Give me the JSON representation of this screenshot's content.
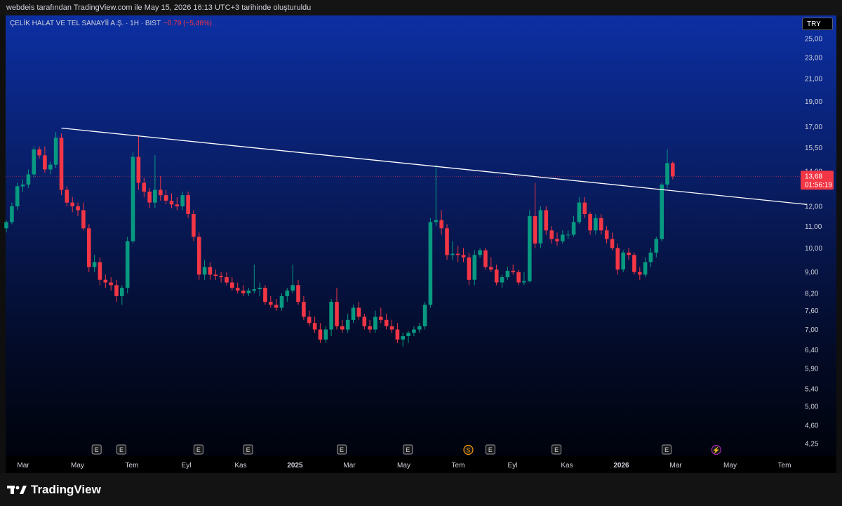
{
  "header_text": "webdeis tarafından TradingView.com ile May 15, 2026 16:13 UTC+3 tarihinde oluşturuldu",
  "legend": {
    "symbol": "ÇELİK HALAT VE TEL SANAYİİ A.Ş. · 1H · BIST",
    "change": "−0,79 (−5,46%)"
  },
  "currency": "TRY",
  "current_price": {
    "price": "13,68",
    "countdown": "01:56:19"
  },
  "brand": "TradingView",
  "colors": {
    "up": "#089981",
    "down": "#f23645",
    "trendline": "#ffffff",
    "event_dividend": "#ff9800",
    "event_split": "#9c27b0"
  },
  "chart_data": {
    "type": "candlestick",
    "currency": "TRY",
    "y_scale": "log",
    "y_ticks": [
      "25,00",
      "23,00",
      "21,00",
      "19,00",
      "17,00",
      "15,50",
      "14,00",
      "12,00",
      "11,00",
      "10,00",
      "9,00",
      "8,20",
      "7,60",
      "7,00",
      "6,40",
      "5,90",
      "5,40",
      "5,00",
      "4,60",
      "4,25"
    ],
    "x_ticks": [
      "Mar",
      "May",
      "Tem",
      "Eyl",
      "Kas",
      "2025",
      "Mar",
      "May",
      "Tem",
      "Eyl",
      "Kas",
      "2026",
      "Mar",
      "May",
      "Tem"
    ],
    "candles": [
      {
        "o": 10.9,
        "h": 11.3,
        "l": 10.7,
        "c": 11.2
      },
      {
        "o": 11.2,
        "h": 12.2,
        "l": 11.1,
        "c": 12.0
      },
      {
        "o": 12.0,
        "h": 13.3,
        "l": 11.8,
        "c": 13.1
      },
      {
        "o": 13.1,
        "h": 13.5,
        "l": 12.8,
        "c": 13.2
      },
      {
        "o": 13.2,
        "h": 14.1,
        "l": 13.0,
        "c": 13.8
      },
      {
        "o": 13.8,
        "h": 15.6,
        "l": 13.6,
        "c": 15.4
      },
      {
        "o": 15.4,
        "h": 15.6,
        "l": 14.8,
        "c": 15.0
      },
      {
        "o": 15.0,
        "h": 15.6,
        "l": 13.9,
        "c": 14.1
      },
      {
        "o": 14.1,
        "h": 14.6,
        "l": 13.8,
        "c": 14.4
      },
      {
        "o": 14.4,
        "h": 16.6,
        "l": 14.2,
        "c": 16.2
      },
      {
        "o": 16.2,
        "h": 16.5,
        "l": 12.6,
        "c": 12.9
      },
      {
        "o": 12.9,
        "h": 13.1,
        "l": 12.0,
        "c": 12.2
      },
      {
        "o": 12.2,
        "h": 12.5,
        "l": 11.7,
        "c": 12.0
      },
      {
        "o": 12.0,
        "h": 12.2,
        "l": 11.5,
        "c": 11.8
      },
      {
        "o": 11.8,
        "h": 12.2,
        "l": 10.8,
        "c": 10.9
      },
      {
        "o": 10.9,
        "h": 11.1,
        "l": 9.0,
        "c": 9.2
      },
      {
        "o": 9.2,
        "h": 9.7,
        "l": 9.0,
        "c": 9.4
      },
      {
        "o": 9.4,
        "h": 9.6,
        "l": 8.5,
        "c": 8.7
      },
      {
        "o": 8.7,
        "h": 8.9,
        "l": 8.4,
        "c": 8.6
      },
      {
        "o": 8.6,
        "h": 8.8,
        "l": 8.3,
        "c": 8.5
      },
      {
        "o": 8.5,
        "h": 8.7,
        "l": 7.9,
        "c": 8.1
      },
      {
        "o": 8.1,
        "h": 8.5,
        "l": 7.8,
        "c": 8.4
      },
      {
        "o": 8.4,
        "h": 10.5,
        "l": 8.2,
        "c": 10.3
      },
      {
        "o": 10.3,
        "h": 15.2,
        "l": 10.2,
        "c": 14.9
      },
      {
        "o": 14.9,
        "h": 16.4,
        "l": 12.9,
        "c": 13.3
      },
      {
        "o": 13.3,
        "h": 13.6,
        "l": 12.5,
        "c": 12.8
      },
      {
        "o": 12.8,
        "h": 13.0,
        "l": 11.9,
        "c": 12.2
      },
      {
        "o": 12.2,
        "h": 15.0,
        "l": 11.9,
        "c": 12.9
      },
      {
        "o": 12.9,
        "h": 13.7,
        "l": 12.3,
        "c": 12.6
      },
      {
        "o": 12.6,
        "h": 12.9,
        "l": 12.1,
        "c": 12.3
      },
      {
        "o": 12.3,
        "h": 12.7,
        "l": 11.9,
        "c": 12.1
      },
      {
        "o": 12.1,
        "h": 12.5,
        "l": 11.8,
        "c": 12.0
      },
      {
        "o": 12.0,
        "h": 12.8,
        "l": 11.8,
        "c": 12.6
      },
      {
        "o": 12.6,
        "h": 12.8,
        "l": 11.4,
        "c": 11.6
      },
      {
        "o": 11.6,
        "h": 11.8,
        "l": 10.3,
        "c": 10.5
      },
      {
        "o": 10.5,
        "h": 10.7,
        "l": 8.7,
        "c": 8.9
      },
      {
        "o": 8.9,
        "h": 9.5,
        "l": 8.7,
        "c": 9.2
      },
      {
        "o": 9.2,
        "h": 9.4,
        "l": 8.7,
        "c": 8.9
      },
      {
        "o": 8.9,
        "h": 9.1,
        "l": 8.7,
        "c": 8.85
      },
      {
        "o": 8.85,
        "h": 9.0,
        "l": 8.6,
        "c": 8.8
      },
      {
        "o": 8.8,
        "h": 9.0,
        "l": 8.5,
        "c": 8.6
      },
      {
        "o": 8.6,
        "h": 8.8,
        "l": 8.3,
        "c": 8.4
      },
      {
        "o": 8.4,
        "h": 8.6,
        "l": 8.2,
        "c": 8.3
      },
      {
        "o": 8.3,
        "h": 8.5,
        "l": 8.1,
        "c": 8.2
      },
      {
        "o": 8.2,
        "h": 8.4,
        "l": 8.1,
        "c": 8.3
      },
      {
        "o": 8.3,
        "h": 9.3,
        "l": 8.2,
        "c": 8.35
      },
      {
        "o": 8.35,
        "h": 8.6,
        "l": 8.1,
        "c": 8.4
      },
      {
        "o": 8.4,
        "h": 8.5,
        "l": 7.8,
        "c": 7.9
      },
      {
        "o": 7.9,
        "h": 8.1,
        "l": 7.7,
        "c": 7.8
      },
      {
        "o": 7.8,
        "h": 8.0,
        "l": 7.6,
        "c": 7.7
      },
      {
        "o": 7.7,
        "h": 8.2,
        "l": 7.6,
        "c": 8.1
      },
      {
        "o": 8.1,
        "h": 8.4,
        "l": 7.9,
        "c": 8.3
      },
      {
        "o": 8.3,
        "h": 9.3,
        "l": 8.2,
        "c": 8.5
      },
      {
        "o": 8.5,
        "h": 8.7,
        "l": 7.8,
        "c": 7.9
      },
      {
        "o": 7.9,
        "h": 8.1,
        "l": 7.3,
        "c": 7.4
      },
      {
        "o": 7.4,
        "h": 7.6,
        "l": 7.1,
        "c": 7.2
      },
      {
        "o": 7.2,
        "h": 7.4,
        "l": 6.9,
        "c": 7.0
      },
      {
        "o": 7.0,
        "h": 7.2,
        "l": 6.6,
        "c": 6.7
      },
      {
        "o": 6.7,
        "h": 7.1,
        "l": 6.6,
        "c": 7.0
      },
      {
        "o": 7.0,
        "h": 8.0,
        "l": 6.8,
        "c": 7.9
      },
      {
        "o": 7.9,
        "h": 8.4,
        "l": 7.0,
        "c": 7.1
      },
      {
        "o": 7.1,
        "h": 7.3,
        "l": 6.9,
        "c": 7.0
      },
      {
        "o": 7.0,
        "h": 7.5,
        "l": 6.9,
        "c": 7.3
      },
      {
        "o": 7.3,
        "h": 7.8,
        "l": 7.2,
        "c": 7.7
      },
      {
        "o": 7.7,
        "h": 7.9,
        "l": 7.3,
        "c": 7.4
      },
      {
        "o": 7.4,
        "h": 7.5,
        "l": 7.0,
        "c": 7.1
      },
      {
        "o": 7.1,
        "h": 7.3,
        "l": 6.9,
        "c": 7.0
      },
      {
        "o": 7.0,
        "h": 7.6,
        "l": 6.9,
        "c": 7.4
      },
      {
        "o": 7.4,
        "h": 7.7,
        "l": 7.2,
        "c": 7.3
      },
      {
        "o": 7.3,
        "h": 7.5,
        "l": 7.0,
        "c": 7.1
      },
      {
        "o": 7.1,
        "h": 7.3,
        "l": 6.9,
        "c": 7.0
      },
      {
        "o": 7.0,
        "h": 7.2,
        "l": 6.6,
        "c": 6.7
      },
      {
        "o": 6.7,
        "h": 6.9,
        "l": 6.5,
        "c": 6.8
      },
      {
        "o": 6.8,
        "h": 6.95,
        "l": 6.6,
        "c": 6.9
      },
      {
        "o": 6.9,
        "h": 7.1,
        "l": 6.8,
        "c": 7.0
      },
      {
        "o": 7.0,
        "h": 7.2,
        "l": 6.9,
        "c": 7.1
      },
      {
        "o": 7.1,
        "h": 7.9,
        "l": 7.0,
        "c": 7.8
      },
      {
        "o": 7.8,
        "h": 11.4,
        "l": 7.7,
        "c": 11.2
      },
      {
        "o": 11.2,
        "h": 14.4,
        "l": 11.0,
        "c": 11.3
      },
      {
        "o": 11.3,
        "h": 11.8,
        "l": 10.6,
        "c": 10.9
      },
      {
        "o": 10.9,
        "h": 11.1,
        "l": 9.5,
        "c": 9.7
      },
      {
        "o": 9.7,
        "h": 10.3,
        "l": 9.5,
        "c": 9.75
      },
      {
        "o": 9.75,
        "h": 10.1,
        "l": 9.4,
        "c": 9.7
      },
      {
        "o": 9.7,
        "h": 10.0,
        "l": 9.4,
        "c": 9.6
      },
      {
        "o": 9.6,
        "h": 9.8,
        "l": 8.5,
        "c": 8.7
      },
      {
        "o": 8.7,
        "h": 9.9,
        "l": 8.5,
        "c": 9.7
      },
      {
        "o": 9.7,
        "h": 10.0,
        "l": 9.6,
        "c": 9.9
      },
      {
        "o": 9.9,
        "h": 10.0,
        "l": 9.1,
        "c": 9.2
      },
      {
        "o": 9.2,
        "h": 9.6,
        "l": 9.0,
        "c": 9.1
      },
      {
        "o": 9.1,
        "h": 9.3,
        "l": 8.5,
        "c": 8.6
      },
      {
        "o": 8.6,
        "h": 8.9,
        "l": 8.4,
        "c": 8.8
      },
      {
        "o": 8.8,
        "h": 9.2,
        "l": 8.7,
        "c": 9.05
      },
      {
        "o": 9.05,
        "h": 9.3,
        "l": 8.9,
        "c": 9.0
      },
      {
        "o": 9.0,
        "h": 9.1,
        "l": 8.5,
        "c": 8.6
      },
      {
        "o": 8.6,
        "h": 9.0,
        "l": 8.5,
        "c": 8.65
      },
      {
        "o": 8.65,
        "h": 11.8,
        "l": 8.6,
        "c": 11.5
      },
      {
        "o": 11.5,
        "h": 13.3,
        "l": 10.0,
        "c": 10.2
      },
      {
        "o": 10.2,
        "h": 12.0,
        "l": 10.0,
        "c": 11.8
      },
      {
        "o": 11.8,
        "h": 12.0,
        "l": 10.6,
        "c": 10.8
      },
      {
        "o": 10.8,
        "h": 11.0,
        "l": 10.2,
        "c": 10.4
      },
      {
        "o": 10.4,
        "h": 10.7,
        "l": 10.1,
        "c": 10.3
      },
      {
        "o": 10.3,
        "h": 10.8,
        "l": 10.2,
        "c": 10.6
      },
      {
        "o": 10.6,
        "h": 10.8,
        "l": 10.4,
        "c": 10.6
      },
      {
        "o": 10.6,
        "h": 11.5,
        "l": 10.5,
        "c": 11.2
      },
      {
        "o": 11.2,
        "h": 12.5,
        "l": 11.1,
        "c": 12.2
      },
      {
        "o": 12.2,
        "h": 12.5,
        "l": 11.4,
        "c": 11.6
      },
      {
        "o": 11.6,
        "h": 11.7,
        "l": 10.6,
        "c": 10.8
      },
      {
        "o": 10.8,
        "h": 11.6,
        "l": 10.6,
        "c": 11.4
      },
      {
        "o": 11.4,
        "h": 11.6,
        "l": 10.6,
        "c": 10.8
      },
      {
        "o": 10.8,
        "h": 11.0,
        "l": 10.2,
        "c": 10.4
      },
      {
        "o": 10.4,
        "h": 10.7,
        "l": 9.9,
        "c": 10.0
      },
      {
        "o": 10.0,
        "h": 10.2,
        "l": 8.9,
        "c": 9.1
      },
      {
        "o": 9.1,
        "h": 9.9,
        "l": 9.0,
        "c": 9.8
      },
      {
        "o": 9.8,
        "h": 10.0,
        "l": 9.5,
        "c": 9.7
      },
      {
        "o": 9.7,
        "h": 9.8,
        "l": 8.9,
        "c": 9.0
      },
      {
        "o": 9.0,
        "h": 9.2,
        "l": 8.7,
        "c": 8.9
      },
      {
        "o": 8.9,
        "h": 9.6,
        "l": 8.8,
        "c": 9.4
      },
      {
        "o": 9.4,
        "h": 10.0,
        "l": 9.2,
        "c": 9.8
      },
      {
        "o": 9.8,
        "h": 10.5,
        "l": 9.6,
        "c": 10.4
      },
      {
        "o": 10.4,
        "h": 13.3,
        "l": 10.3,
        "c": 13.2
      },
      {
        "o": 13.2,
        "h": 15.4,
        "l": 13.0,
        "c": 14.5
      },
      {
        "o": 14.5,
        "h": 14.6,
        "l": 13.5,
        "c": 13.68
      }
    ],
    "trendline": {
      "from_index": 10,
      "from_price": 16.9,
      "to_index": 145.3,
      "to_price": 12.1
    },
    "event_markers": [
      {
        "label": "E",
        "type": "earnings",
        "index": 15.5
      },
      {
        "label": "E",
        "type": "earnings",
        "index": 20
      },
      {
        "label": "E",
        "type": "earnings",
        "index": 34
      },
      {
        "label": "E",
        "type": "earnings",
        "index": 43
      },
      {
        "label": "E",
        "type": "earnings",
        "index": 60
      },
      {
        "label": "E",
        "type": "earnings",
        "index": 72
      },
      {
        "label": "S",
        "type": "dividend",
        "index": 83
      },
      {
        "label": "E",
        "type": "earnings",
        "index": 87
      },
      {
        "label": "E",
        "type": "earnings",
        "index": 99
      },
      {
        "label": "E",
        "type": "earnings",
        "index": 119
      },
      {
        "label": "⚡",
        "type": "split",
        "index": 128
      }
    ]
  }
}
